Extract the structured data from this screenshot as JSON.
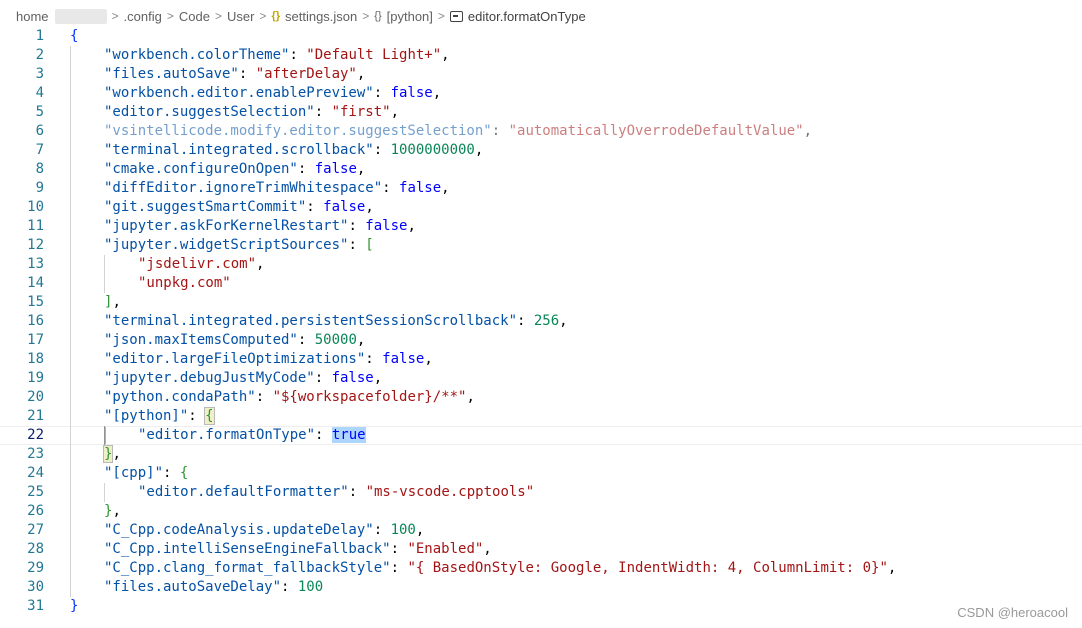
{
  "breadcrumb": {
    "items": [
      "home",
      ".config",
      "Code",
      "User",
      "settings.json",
      "[python]",
      "editor.formatOnType"
    ],
    "separator": ">",
    "json_icon": "{}",
    "object_icon": "{}"
  },
  "editor": {
    "line_numbers": [
      "1",
      "2",
      "3",
      "4",
      "5",
      "6",
      "7",
      "8",
      "9",
      "10",
      "11",
      "12",
      "13",
      "14",
      "15",
      "16",
      "17",
      "18",
      "19",
      "20",
      "21",
      "22",
      "23",
      "24",
      "25",
      "26",
      "27",
      "28",
      "29",
      "30",
      "31"
    ],
    "current_line": "22",
    "lines": [
      {
        "open": "{"
      },
      {
        "key": "\"workbench.colorTheme\"",
        "str": "\"Default Light+\""
      },
      {
        "key": "\"files.autoSave\"",
        "str": "\"afterDelay\""
      },
      {
        "key": "\"workbench.editor.enablePreview\"",
        "kw": "false"
      },
      {
        "key": "\"editor.suggestSelection\"",
        "str": "\"first\""
      },
      {
        "key": "\"vsintellicode.modify.editor.suggestSelection\"",
        "str": "\"automaticallyOverrodeDefaultValue\""
      },
      {
        "key": "\"terminal.integrated.scrollback\"",
        "num": "1000000000"
      },
      {
        "key": "\"cmake.configureOnOpen\"",
        "kw": "false"
      },
      {
        "key": "\"diffEditor.ignoreTrimWhitespace\"",
        "kw": "false"
      },
      {
        "key": "\"git.suggestSmartCommit\"",
        "kw": "false"
      },
      {
        "key": "\"jupyter.askForKernelRestart\"",
        "kw": "false"
      },
      {
        "key": "\"jupyter.widgetScriptSources\"",
        "open": "["
      },
      {
        "str": "\"jsdelivr.com\""
      },
      {
        "str": "\"unpkg.com\""
      },
      {
        "close": "]"
      },
      {
        "key": "\"terminal.integrated.persistentSessionScrollback\"",
        "num": "256"
      },
      {
        "key": "\"json.maxItemsComputed\"",
        "num": "50000"
      },
      {
        "key": "\"editor.largeFileOptimizations\"",
        "kw": "false"
      },
      {
        "key": "\"jupyter.debugJustMyCode\"",
        "kw": "false"
      },
      {
        "key": "\"python.condaPath\"",
        "str": "\"${workspacefolder}/**\""
      },
      {
        "key": "\"[python]\"",
        "open": "{"
      },
      {
        "key": "\"editor.formatOnType\"",
        "kw": "true"
      },
      {
        "close": "}"
      },
      {
        "key": "\"[cpp]\"",
        "open": "{"
      },
      {
        "key": "\"editor.defaultFormatter\"",
        "str": "\"ms-vscode.cpptools\""
      },
      {
        "close": "}"
      },
      {
        "key": "\"C_Cpp.codeAnalysis.updateDelay\"",
        "num": "100"
      },
      {
        "key": "\"C_Cpp.intelliSenseEngineFallback\"",
        "str": "\"Enabled\""
      },
      {
        "key": "\"C_Cpp.clang_format_fallbackStyle\"",
        "str": "\"{ BasedOnStyle: Google, IndentWidth: 4, ColumnLimit: 0}\""
      },
      {
        "key": "\"files.autoSaveDelay\"",
        "num": "100"
      },
      {
        "close": "}"
      }
    ],
    "punct": {
      "colon": ": ",
      "comma": ","
    }
  },
  "watermark": "CSDN @heroacool",
  "colors": {
    "key": "#0451a5",
    "string": "#a31515",
    "number": "#098658",
    "keyword": "#0000ff",
    "line_number": "#237893",
    "selection": "#add6ff"
  }
}
